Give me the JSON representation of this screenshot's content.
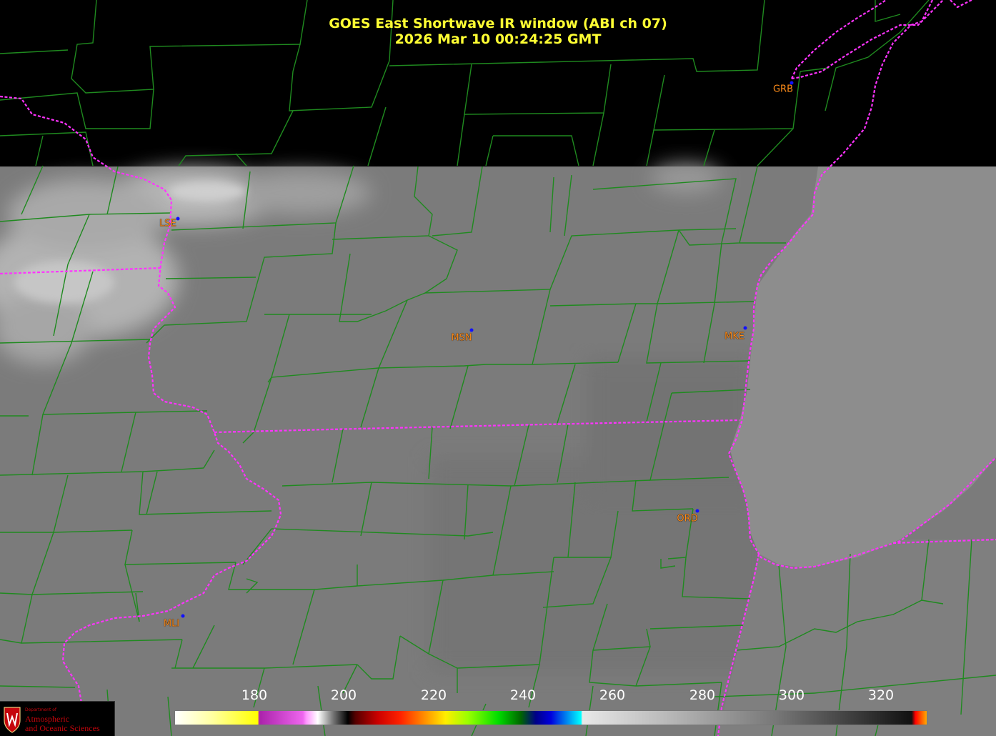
{
  "title": {
    "line1": "GOES East Shortwave IR window (ABI ch 07)",
    "line2": "2026 Mar 10  00:24:25 GMT"
  },
  "stations": [
    {
      "id": "GRB",
      "label": "GRB"
    },
    {
      "id": "LSE",
      "label": "LSE"
    },
    {
      "id": "MSN",
      "label": "MSN"
    },
    {
      "id": "MKE",
      "label": "MKE"
    },
    {
      "id": "ORD",
      "label": "ORD"
    },
    {
      "id": "MLI",
      "label": "MLI"
    }
  ],
  "colorbar": {
    "ticks": [
      "180",
      "200",
      "220",
      "240",
      "260",
      "280",
      "300",
      "320"
    ]
  },
  "logo": {
    "dept": "Department of",
    "line1": "Atmospheric",
    "line2": "and Oceanic Sciences"
  },
  "colors": {
    "title": "#ffff33",
    "county_lines": "#1f8a1f",
    "state_lines": "#ff33ff",
    "station_label": "#ff8c1a",
    "station_dot": "#1010ff",
    "land_gray": "#7b7b7b",
    "lake_gray": "#8d8d8d",
    "cloud_gray": "#b8b8b8"
  }
}
